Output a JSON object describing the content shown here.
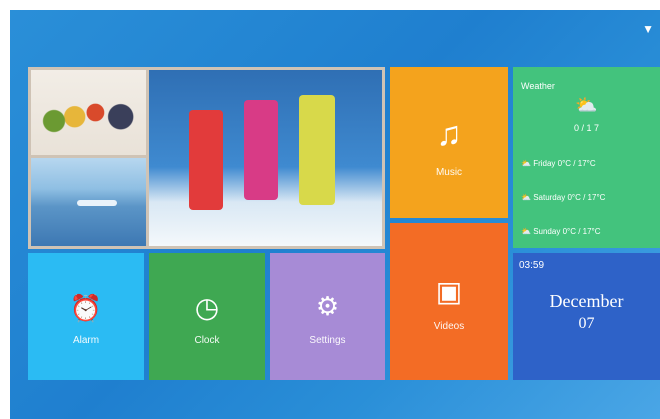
{
  "status": {
    "wifi_icon": "wifi-icon"
  },
  "tiles": {
    "music": {
      "label": "Music",
      "icon": "music-note-icon"
    },
    "videos": {
      "label": "Videos",
      "icon": "video-icon"
    },
    "alarm": {
      "label": "Alarm",
      "icon": "alarm-clock-icon"
    },
    "clock": {
      "label": "Clock",
      "icon": "clock-icon"
    },
    "settings": {
      "label": "Settings",
      "icon": "gear-icon"
    }
  },
  "weather": {
    "title": "Weather",
    "temp": "0 / 1 7",
    "forecast": [
      {
        "day": "Friday",
        "range": "0°C / 17°C"
      },
      {
        "day": "Saturday",
        "range": "0°C / 17°C"
      },
      {
        "day": "Sunday",
        "range": "0°C / 17°C"
      }
    ]
  },
  "datetime": {
    "time": "03:59",
    "month": "December",
    "day": "07"
  },
  "colors": {
    "music": "#f4a31d",
    "weather": "#43c37d",
    "videos": "#f36c25",
    "date": "#2e62c8",
    "alarm": "#2bbbf3",
    "clock": "#3fa852",
    "settings": "#a78bd6"
  }
}
